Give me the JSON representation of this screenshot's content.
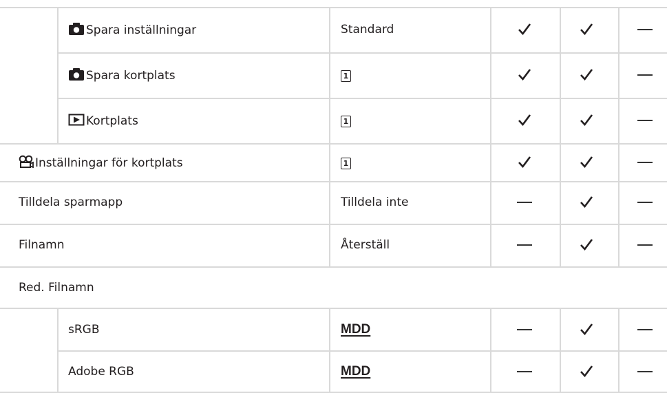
{
  "rows": [
    {
      "label": "Spara inställningar",
      "icon": "camera-icon",
      "value": "Standard",
      "marks": [
        "check",
        "check",
        "dash"
      ]
    },
    {
      "label": "Spara kortplats",
      "icon": "camera-icon",
      "value": "1",
      "value_icon": "card-slot-icon",
      "marks": [
        "check",
        "check",
        "dash"
      ]
    },
    {
      "label": "Kortplats",
      "icon": "playback-icon",
      "value": "1",
      "value_icon": "card-slot-icon",
      "marks": [
        "check",
        "check",
        "dash"
      ]
    },
    {
      "label": "Inställningar för kortplats",
      "icon": "video-icon",
      "value": "1",
      "value_icon": "card-slot-icon",
      "marks": [
        "check",
        "check",
        "dash"
      ]
    },
    {
      "label": "Tilldela sparmapp",
      "value": "Tilldela inte",
      "marks": [
        "dash",
        "check",
        "dash"
      ]
    },
    {
      "label": "Filnamn",
      "value": "Återställ",
      "marks": [
        "dash",
        "check",
        "dash"
      ]
    },
    {
      "label": "Red. Filnamn"
    },
    {
      "label": "sRGB",
      "value": "MDD",
      "marks": [
        "dash",
        "check",
        "dash"
      ]
    },
    {
      "label": "Adobe RGB",
      "value": "MDD",
      "marks": [
        "dash",
        "check",
        "dash"
      ]
    }
  ]
}
